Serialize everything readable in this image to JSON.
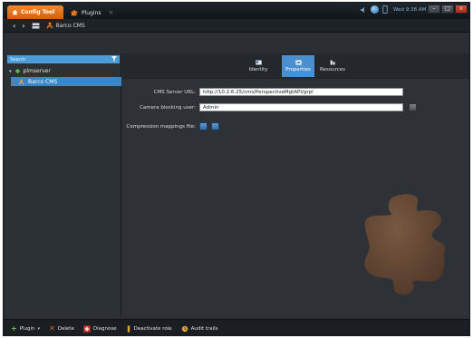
{
  "titlebar": {
    "app_tab_label": "Config Tool",
    "plugin_tab_label": "Plugins",
    "plugin_tab_close": "×",
    "center_title": "",
    "clock": "Wed 9:38 AM",
    "min_label": "–",
    "max_label": "□",
    "close_label": "x"
  },
  "navbar": {
    "back": "‹",
    "forward": "›",
    "current": "Barco CMS"
  },
  "tree": {
    "search_placeholder": "Search",
    "root": "plmserver",
    "child": "Barco CMS"
  },
  "tabs": [
    {
      "label": "Identity",
      "icon": "identity-icon"
    },
    {
      "label": "Properties",
      "icon": "properties-icon"
    },
    {
      "label": "Resources",
      "icon": "resources-icon"
    }
  ],
  "form": {
    "cms_url_label": "CMS Server URL:",
    "cms_url_value": "http://10.2.6.25/cms/PerspectiveMgtAPI/grpl",
    "camera_user_label": "Camera blocking user:",
    "camera_user_value": "Admin",
    "compression_label": "Compression mappings file:"
  },
  "toolbar": {
    "plugin": "Plugin",
    "delete": "Delete",
    "diagnose": "Diagnose",
    "deactivate": "Deactivate role",
    "audit": "Audit trails"
  },
  "colors": {
    "accent": "#4a8fcf",
    "app_tab": "#e8761f",
    "background": "#2e3236"
  }
}
